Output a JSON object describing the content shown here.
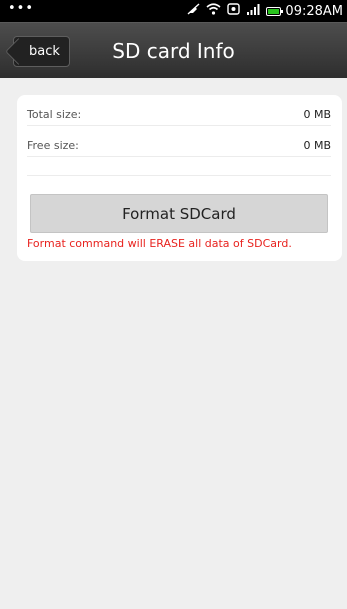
{
  "status_bar": {
    "menu_dots": "•••",
    "icons": [
      "mute-icon",
      "wifi-icon",
      "nfc-icon",
      "signal-icon",
      "battery-icon"
    ],
    "time": "09:28AM",
    "battery_color": "#29c21d"
  },
  "header": {
    "back_label": "back",
    "title": "SD card Info"
  },
  "sd_info": {
    "total_label": "Total size:",
    "total_value": "0 MB",
    "free_label": "Free size:",
    "free_value": "0 MB"
  },
  "actions": {
    "format_label": "Format SDCard",
    "warning": "Format command will ERASE all data of SDCard.",
    "warning_color": "#e8231f"
  }
}
